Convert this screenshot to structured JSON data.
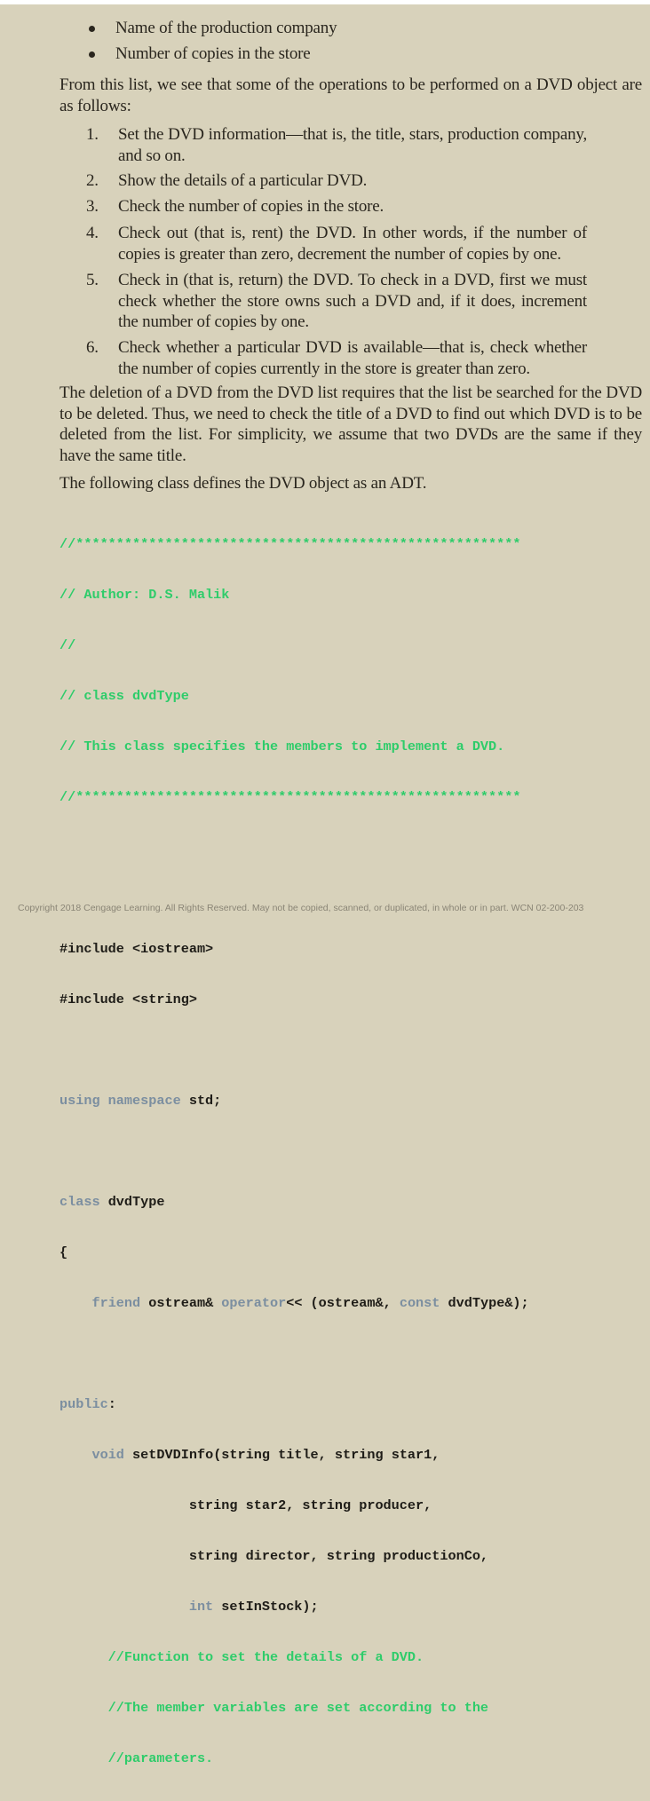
{
  "bullets": [
    "Name of the production company",
    "Number of copies in the store"
  ],
  "intro_paragraph": "From this list, we see that some of the operations to be performed on a DVD object are as follows:",
  "operations": [
    {
      "num": "1.",
      "text": "Set the DVD information—that is, the title, stars, production company, and so on."
    },
    {
      "num": "2.",
      "text": "Show the details of a particular DVD."
    },
    {
      "num": "3.",
      "text": "Check the number of copies in the store."
    },
    {
      "num": "4.",
      "text": "Check out (that is, rent) the DVD. In other words, if the number of copies is greater than zero, decrement the number of copies by one."
    },
    {
      "num": "5.",
      "text": "Check in (that is, return) the DVD. To check in a DVD, first we must check whether the store owns such a DVD and, if it does, increment the number of copies by one."
    },
    {
      "num": "6.",
      "text": "Check whether a particular DVD is available—that is, check whether the number of copies currently in the store is greater than zero."
    }
  ],
  "deletion_paragraph": "The deletion of a DVD from the DVD list requires that the list be searched for the DVD to be deleted. Thus, we need to check the title of a DVD to find out which DVD is to be deleted from the list. For simplicity, we assume that two DVDs are the same if they have the same title.",
  "adt_paragraph": "The following class defines the DVD object as an ADT.",
  "code": {
    "header_comment": [
      "//*******************************************************",
      "// Author: D.S. Malik",
      "//",
      "// class dvdType",
      "// This class specifies the members to implement a DVD.",
      "//*******************************************************"
    ],
    "include1": "#include <iostream>",
    "include2": "#include <string>",
    "using_kw": "using namespace",
    "using_rest": " std;",
    "class_kw": "class",
    "class_name": " dvdType",
    "open_brace": "{",
    "friend_indent": "    ",
    "friend_kw": "friend",
    "friend_mid1": " ostream& ",
    "operator_kw": "operator",
    "friend_mid2": "<< (ostream&, ",
    "const_kw": "const",
    "friend_end": " dvdType&);",
    "public_kw": "public",
    "public_colon": ":",
    "void_indent": "    ",
    "void_kw": "void",
    "setinfo_line1": " setDVDInfo(string title, string star1,",
    "setinfo_line2": "                string star2, string producer,",
    "setinfo_line3": "                string director, string productionCo,",
    "int_indent": "                ",
    "int_kw": "int",
    "setinfo_line4_rest": " setInStock);",
    "fn_comments": [
      "      //Function to set the details of a DVD.",
      "      //The member variables are set according to the",
      "      //parameters."
    ]
  },
  "footer": "Copyright 2018 Cengage Learning. All Rights Reserved. May not be copied, scanned, or duplicated, in whole or in part.  WCN 02-200-203",
  "colors": {
    "page_background": "#d8d2bb",
    "body_text": "#2a261e",
    "code_comment": "#2ecc6a",
    "code_keyword": "#7b8ea0",
    "code_text": "#1e1c17"
  }
}
